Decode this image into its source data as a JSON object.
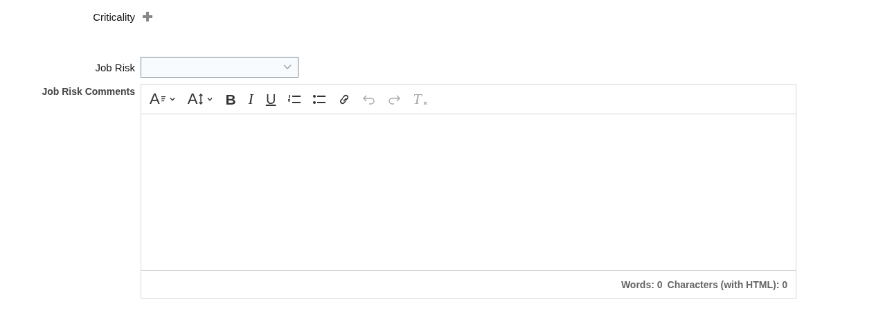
{
  "criticality": {
    "label": "Criticality"
  },
  "job_risk": {
    "label": "Job Risk"
  },
  "job_risk_comments": {
    "label": "Job Risk Comments",
    "toolbar": [
      {
        "kind": "font",
        "glyph": "A",
        "dropdown": true,
        "disabled": false
      },
      {
        "kind": "size",
        "glyph": "A",
        "dropdown": true,
        "disabled": false
      },
      {
        "kind": "bold",
        "glyph": "B",
        "dropdown": false,
        "disabled": false
      },
      {
        "kind": "italic",
        "glyph": "I",
        "dropdown": false,
        "disabled": false
      },
      {
        "kind": "underline",
        "glyph": "U",
        "dropdown": false,
        "disabled": false
      },
      {
        "kind": "ordered",
        "dropdown": false,
        "disabled": false
      },
      {
        "kind": "bullets",
        "dropdown": false,
        "disabled": false
      },
      {
        "kind": "link",
        "dropdown": false,
        "disabled": false
      },
      {
        "kind": "undo",
        "dropdown": false,
        "disabled": true
      },
      {
        "kind": "redo",
        "dropdown": false,
        "disabled": true
      },
      {
        "kind": "clear",
        "glyph": "T",
        "dropdown": false,
        "disabled": true
      }
    ],
    "words": "Words: 0",
    "characters": "Characters (with HTML): 0"
  }
}
